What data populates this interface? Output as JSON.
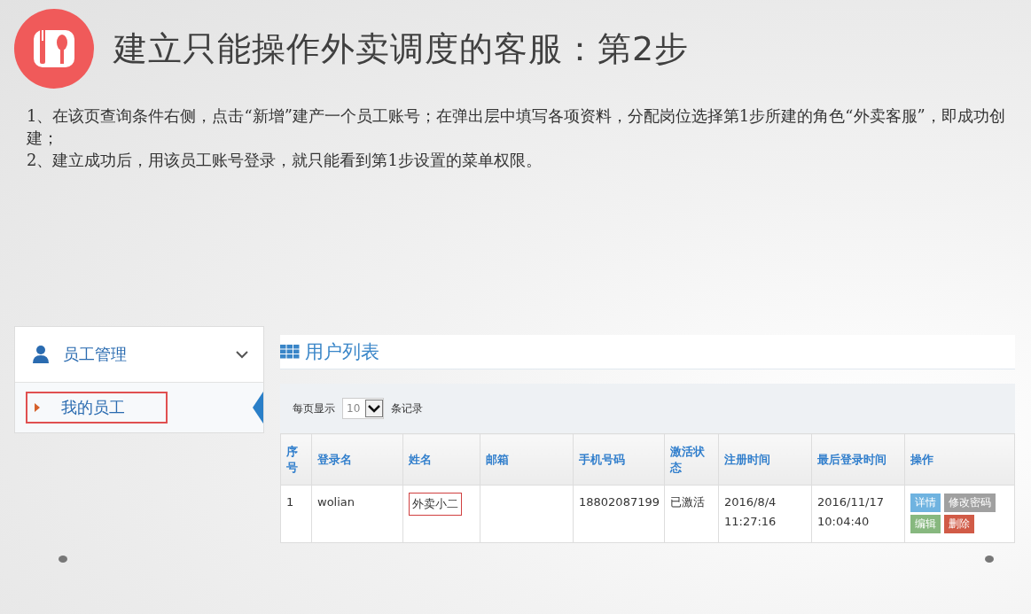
{
  "header": {
    "title": "建立只能操作外卖调度的客服：第2步"
  },
  "instructions": [
    "1、在该页查询条件右侧，点击“新增”建产一个员工账号；在弹出层中填写各项资料，分配岗位选择第1步所建的角色“外卖客服”，即成功创建；",
    "2、建立成功后，用该员工账号登录，就只能看到第1步设置的菜单权限。"
  ],
  "sidebar": {
    "group_label": "员工管理",
    "expanded": true,
    "items": [
      {
        "label": "我的员工",
        "selected": true,
        "highlighted": true
      }
    ]
  },
  "panel": {
    "title": "用户列表",
    "page_size": {
      "label_before": "每页显示",
      "value": "10",
      "label_after": "条记录"
    },
    "table": {
      "columns": [
        "序号",
        "登录名",
        "姓名",
        "邮箱",
        "手机号码",
        "激活状态",
        "注册时间",
        "最后登录时间",
        "操作"
      ],
      "rows": [
        {
          "cells": [
            {
              "text": "1",
              "highlighted": false
            },
            {
              "text": "wolian",
              "highlighted": false
            },
            {
              "text": "外卖小二",
              "highlighted": true
            },
            {
              "text": "",
              "highlighted": false
            },
            {
              "text": "18802087199",
              "highlighted": false
            },
            {
              "text": "已激活",
              "highlighted": false
            },
            {
              "text": "2016/8/4 11:27:16",
              "highlighted": false
            },
            {
              "text": "2016/11/17 10:04:40",
              "highlighted": false
            }
          ],
          "actions": [
            {
              "label": "详情",
              "color": "#6fb3e0"
            },
            {
              "label": "修改密码",
              "color": "#a0a0a0"
            },
            {
              "label": "编辑",
              "color": "#87b87f"
            },
            {
              "label": "删除",
              "color": "#d15b47"
            }
          ]
        }
      ]
    }
  }
}
